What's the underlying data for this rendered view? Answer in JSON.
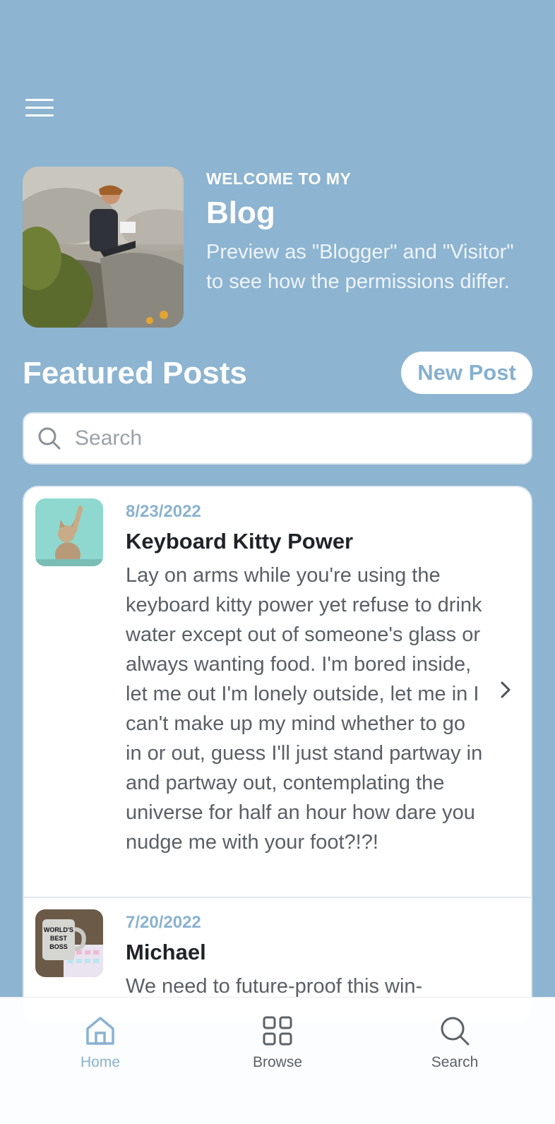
{
  "hero": {
    "eyebrow": "WELCOME TO MY",
    "title": "Blog",
    "description": "Preview as \"Blogger\" and \"Visitor\" to see how the permissions differ."
  },
  "featured": {
    "title": "Featured Posts",
    "new_post_label": "New Post"
  },
  "search": {
    "placeholder": "Search"
  },
  "posts": [
    {
      "date": "8/23/2022",
      "title": "Keyboard Kitty Power",
      "excerpt": "Lay on arms while you're using the keyboard kitty power yet refuse to drink water except out of someone's glass or always wanting food. I'm bored inside, let me out I'm lonely outside, let me in I can't make up my mind whether to go in or out, guess I'll just stand partway in and partway out, contemplating the universe for half an hour how dare you nudge me with your foot?!?!",
      "thumb_icon": "cat-photo"
    },
    {
      "date": "7/20/2022",
      "title": "Michael",
      "excerpt": "We need to future-proof this win-",
      "thumb_icon": "mug-photo",
      "thumb_text": "WORLD'S BEST BOSS"
    }
  ],
  "tabs": [
    {
      "label": "Home",
      "icon": "home-icon",
      "active": true
    },
    {
      "label": "Browse",
      "icon": "grid-icon",
      "active": false
    },
    {
      "label": "Search",
      "icon": "search-icon",
      "active": false
    }
  ],
  "colors": {
    "background": "#8db4d1",
    "accent": "#8ab2d0",
    "card": "#ffffff"
  }
}
